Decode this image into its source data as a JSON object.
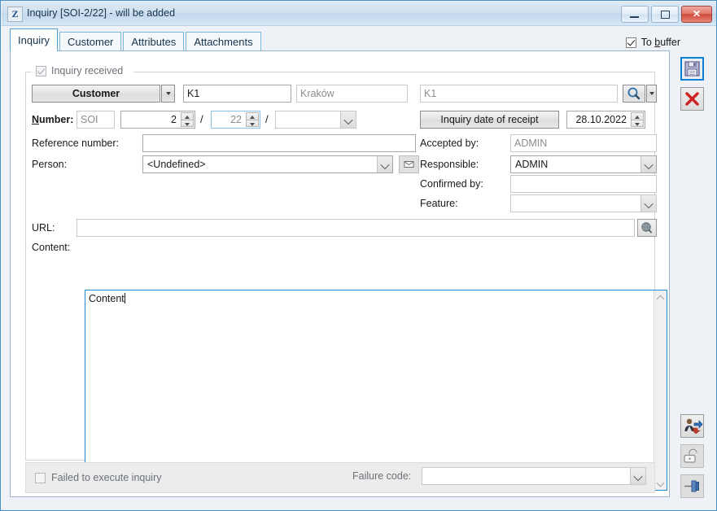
{
  "window": {
    "app_icon_letter": "Z",
    "title": "Inquiry [SOI-2/22] - will be added",
    "minimize_label": "Minimize",
    "maximize_label": "Maximize",
    "close_label": "Close"
  },
  "tabs": [
    {
      "label": "Inquiry",
      "active": true
    },
    {
      "label": "Customer",
      "active": false
    },
    {
      "label": "Attributes",
      "active": false
    },
    {
      "label": "Attachments",
      "active": false
    }
  ],
  "to_buffer": {
    "label_before": "To ",
    "label_accel": "b",
    "label_after": "uffer",
    "checked": true
  },
  "group": {
    "legend": "Inquiry received",
    "legend_checked": true
  },
  "customer_row": {
    "button_label": "Customer",
    "code_value": "K1",
    "city_value": "Kraków",
    "name_value": "K1",
    "search_icon": "magnifier-icon",
    "dropdown_icon": "chevron-down-icon"
  },
  "number_row": {
    "label_accel": "N",
    "label_rest": "umber:",
    "prefix": "SOI",
    "serial": "2",
    "year": "22",
    "suffix": "",
    "separator": "/"
  },
  "date_row": {
    "button_label": "Inquiry date of receipt",
    "value": "28.10.2022"
  },
  "fields": {
    "reference_number_label": "Reference number:",
    "reference_number_value": "",
    "person_label": "Person:",
    "person_value": "<Undefined>",
    "person_mail_icon": "envelope-icon",
    "accepted_by_label": "Accepted by:",
    "accepted_by_value": "ADMIN",
    "responsible_label": "Responsible:",
    "responsible_value": "ADMIN",
    "confirmed_by_label": "Confirmed by:",
    "confirmed_by_value": "",
    "feature_label": "Feature:",
    "feature_value": "",
    "url_label": "URL:",
    "url_value": "",
    "url_browse_icon": "globe-icon",
    "content_label": "Content:",
    "content_value": "Content"
  },
  "bottom": {
    "failed_label": "Failed to execute inquiry",
    "failed_checked": false,
    "failure_code_label": "Failure code:",
    "failure_code_value": ""
  },
  "toolbar": {
    "save_icon": "floppy-disk-save-icon",
    "cancel_icon": "red-x-cancel-icon",
    "person_icon": "user-assign-icon",
    "unlock_icon": "open-padlock-icon",
    "pin_icon": "pin-icon"
  },
  "colors": {
    "accent": "#1f8ad0",
    "window_border": "#4a8ec2",
    "titlebar": "#cfe0f0",
    "close_button": "#d04a3a",
    "panel_bg": "#ffffff",
    "strip_bg": "#ececec"
  }
}
